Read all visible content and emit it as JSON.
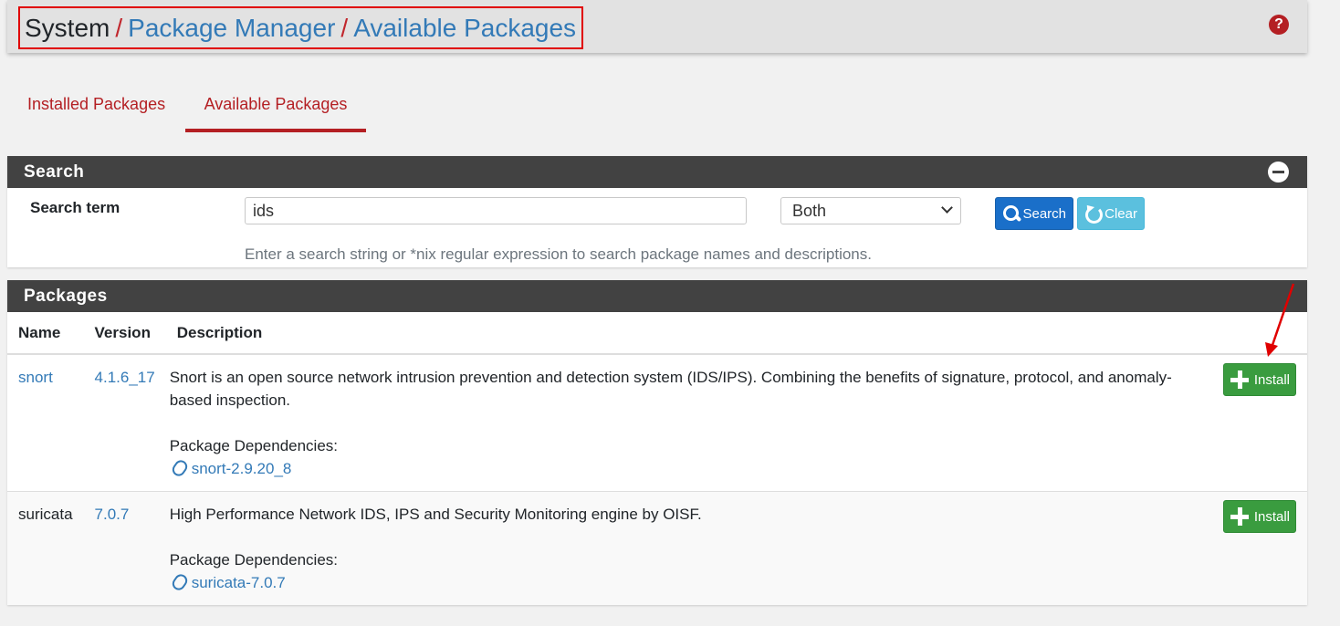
{
  "breadcrumb": {
    "system": "System",
    "sep1": "/",
    "package_manager": "Package Manager",
    "sep2": "/",
    "available_packages": "Available Packages"
  },
  "help": {
    "label": "?"
  },
  "tabs": [
    {
      "label": "Installed Packages",
      "active": false
    },
    {
      "label": "Available Packages",
      "active": true
    }
  ],
  "search_panel": {
    "title": "Search",
    "term_label": "Search term",
    "term_value": "ids",
    "scope_selected": "Both",
    "search_button": "Search",
    "clear_button": "Clear",
    "help_text": "Enter a search string or *nix regular expression to search package names and descriptions."
  },
  "packages_panel": {
    "title": "Packages",
    "columns": [
      "Name",
      "Version",
      "Description"
    ],
    "rows": [
      {
        "name": "snort",
        "version": "4.1.6_17",
        "description": "Snort is an open source network intrusion prevention and detection system (IDS/IPS). Combining the benefits of signature, protocol, and anomaly-based inspection.",
        "deps_label": "Package Dependencies:",
        "dependency": "snort-2.9.20_8",
        "install_label": "Install"
      },
      {
        "name": "suricata",
        "version": "7.0.7",
        "description": "High Performance Network IDS, IPS and Security Monitoring engine by OISF.",
        "deps_label": "Package Dependencies:",
        "dependency": "suricata-7.0.7",
        "install_label": "Install"
      }
    ]
  },
  "colors": {
    "accent_red": "#b41f23",
    "link_blue": "#337ab7",
    "panel_heading": "#424242",
    "install_green": "#3a9c3f",
    "search_blue": "#1a6fc9",
    "clear_cyan": "#5bc0de",
    "highlight_box": "#e00000"
  }
}
